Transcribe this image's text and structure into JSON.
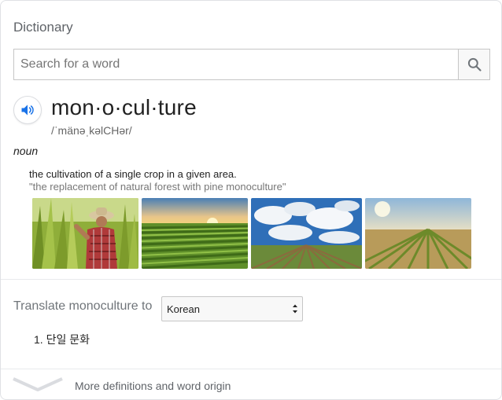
{
  "header": {
    "title": "Dictionary"
  },
  "search": {
    "placeholder": "Search for a word",
    "value": ""
  },
  "entry": {
    "word": "mon·o·cul·ture",
    "phonetic": "/ˈmänəˌkəlCHər/",
    "part_of_speech": "noun",
    "definition": "the cultivation of a single crop in a given area.",
    "example": "\"the replacement of natural forest with pine monoculture\""
  },
  "images": [
    {
      "name": "farmer-corn-image"
    },
    {
      "name": "sunset-field-image"
    },
    {
      "name": "cloudy-field-image"
    },
    {
      "name": "sunrise-field-image"
    }
  ],
  "translate": {
    "label": "Translate monoculture to",
    "selected_language": "Korean",
    "results": [
      "1. 단일 문화"
    ]
  },
  "footer": {
    "more_label": "More definitions and word origin"
  },
  "colors": {
    "accent": "#1a73e8",
    "icon_gray": "#70757a",
    "muted": "#70757a"
  }
}
